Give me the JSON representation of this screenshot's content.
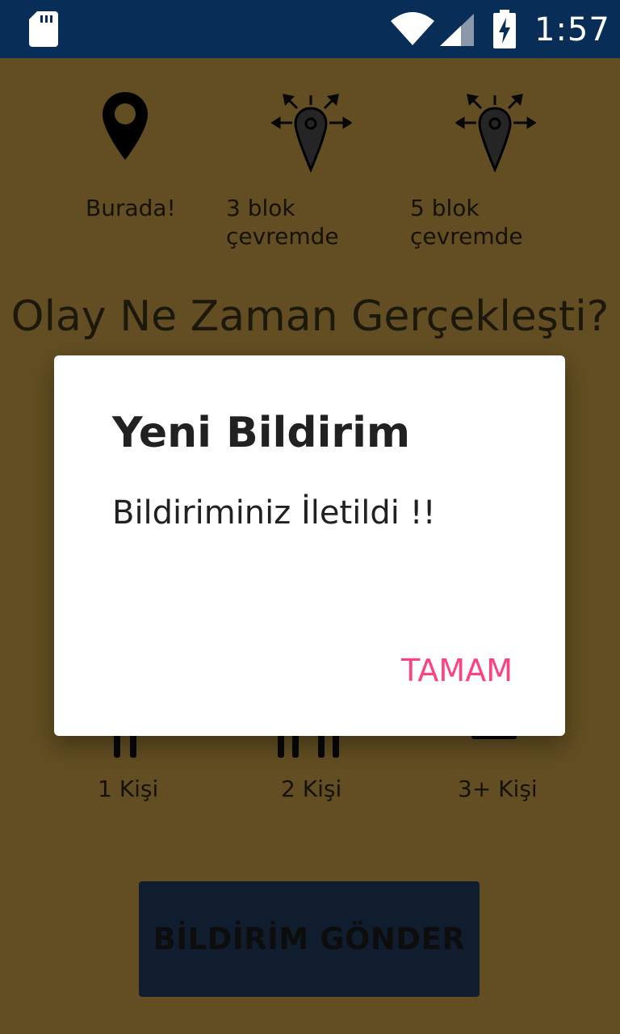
{
  "status_bar": {
    "time": "1:57",
    "icons": [
      "sd-card-icon",
      "wifi-icon",
      "cell-signal-icon",
      "battery-charging-icon"
    ]
  },
  "location_options": [
    {
      "label": "Burada!",
      "icon": "map-pin-icon"
    },
    {
      "label": "3 blok çevremde",
      "icon": "pin-radius-icon"
    },
    {
      "label": "5 blok çevremde",
      "icon": "pin-radius-icon"
    }
  ],
  "question": "Olay Ne Zaman Gerçekleşti?",
  "person_options": [
    {
      "label": "1 Kişi",
      "icon": "one-person-icon"
    },
    {
      "label": "2 Kişi",
      "icon": "two-people-icon"
    },
    {
      "label": "3+ Kişi",
      "icon": "group-icon"
    }
  ],
  "send_button": "BİLDİRİM GÖNDER",
  "dialog": {
    "title": "Yeni Bildirim",
    "message": "Bildiriminiz İletildi !!",
    "ok_label": "TAMAM"
  },
  "colors": {
    "status_bar": "#082d56",
    "app_background": "#c59d45",
    "send_button": "#1e3b5f",
    "dialog_accent": "#ff4081"
  }
}
